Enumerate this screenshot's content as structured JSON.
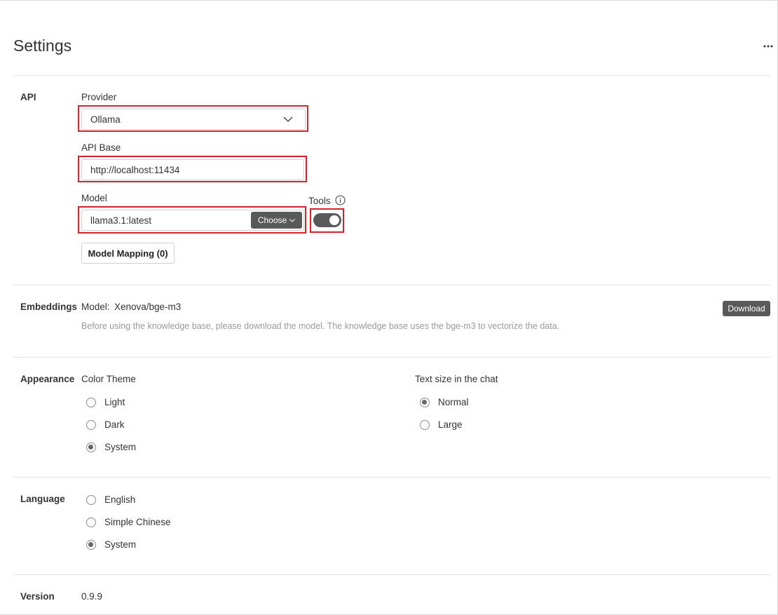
{
  "page": {
    "title": "Settings"
  },
  "api": {
    "section_label": "API",
    "provider_label": "Provider",
    "provider_value": "Ollama",
    "api_base_label": "API Base",
    "api_base_value": "http://localhost:11434",
    "model_label": "Model",
    "model_value": "llama3.1:latest",
    "choose_label": "Choose",
    "tools_label": "Tools",
    "tools_enabled": true,
    "model_mapping_label": "Model Mapping (0)"
  },
  "embeddings": {
    "section_label": "Embeddings",
    "model_prefix": "Model:",
    "model_name": "Xenova/bge-m3",
    "download_label": "Download",
    "description": "Before using the knowledge base, please download the model. The knowledge base uses the bge-m3 to vectorize the data."
  },
  "appearance": {
    "section_label": "Appearance",
    "color_theme_label": "Color Theme",
    "theme_options": [
      {
        "label": "Light",
        "checked": false
      },
      {
        "label": "Dark",
        "checked": false
      },
      {
        "label": "System",
        "checked": true
      }
    ],
    "text_size_label": "Text size in the chat",
    "text_size_options": [
      {
        "label": "Normal",
        "checked": true
      },
      {
        "label": "Large",
        "checked": false
      }
    ]
  },
  "language": {
    "section_label": "Language",
    "options": [
      {
        "label": "English",
        "checked": false
      },
      {
        "label": "Simple Chinese",
        "checked": false
      },
      {
        "label": "System",
        "checked": true
      }
    ]
  },
  "version": {
    "section_label": "Version",
    "value": "0.9.9"
  },
  "colors": {
    "highlight_red": "#d9202b",
    "button_dark": "#595959",
    "muted_text": "#9a9a9a"
  }
}
